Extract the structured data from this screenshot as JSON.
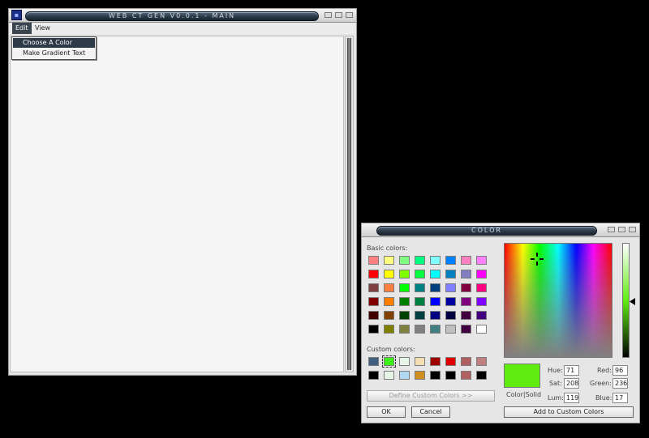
{
  "main_window": {
    "title": "WEB CT GEN V0.0.1 - MAIN",
    "menu": [
      {
        "label": "Edit",
        "active": true
      },
      {
        "label": "View",
        "active": false
      }
    ],
    "dropdown": [
      {
        "label": "Choose A Color",
        "highlighted": true
      },
      {
        "label": "Make Gradient Text",
        "highlighted": false
      }
    ]
  },
  "color_dialog": {
    "title": "COLOR",
    "basic_label": "Basic colors:",
    "custom_label": "Custom colors:",
    "basic_colors": [
      "#ff8080",
      "#ffff80",
      "#80ff80",
      "#00ff80",
      "#80ffff",
      "#0080ff",
      "#ff80c0",
      "#ff80ff",
      "#ff0000",
      "#ffff00",
      "#80ff00",
      "#00ff40",
      "#00ffff",
      "#0080c0",
      "#8080c0",
      "#ff00ff",
      "#804040",
      "#ff8040",
      "#00ff00",
      "#008080",
      "#004080",
      "#8080ff",
      "#800040",
      "#ff0080",
      "#800000",
      "#ff8000",
      "#008000",
      "#008040",
      "#0000ff",
      "#0000a0",
      "#800080",
      "#8000ff",
      "#400000",
      "#804000",
      "#004000",
      "#004040",
      "#000080",
      "#000040",
      "#400040",
      "#400080",
      "#000000",
      "#808000",
      "#808040",
      "#808080",
      "#408080",
      "#c0c0c0",
      "#400040",
      "#ffffff"
    ],
    "custom_colors": [
      "#40607f",
      "#3df217",
      "#e6f5e6",
      "#f5deb3",
      "#a00000",
      "#e00000",
      "#b06060",
      "#c08080",
      "#000000",
      "#e6f5e6",
      "#b0d8f0",
      "#d09020",
      "#000000",
      "#000000",
      "#b06060",
      "#000000"
    ],
    "selected_custom_index": 1,
    "define_custom_label": "Define Custom Colors >>",
    "ok_label": "OK",
    "cancel_label": "Cancel",
    "add_custom_label": "Add to Custom Colors",
    "preview_color": "#60ec11",
    "preview_label": "Color|Solid",
    "hue_label": "Hue:",
    "hue": "71",
    "sat_label": "Sat:",
    "sat": "208",
    "lum_label": "Lum:",
    "lum": "119",
    "red_label": "Red:",
    "red": "96",
    "green_label": "Green:",
    "green": "236",
    "blue_label": "Blue:",
    "blue": "17"
  }
}
